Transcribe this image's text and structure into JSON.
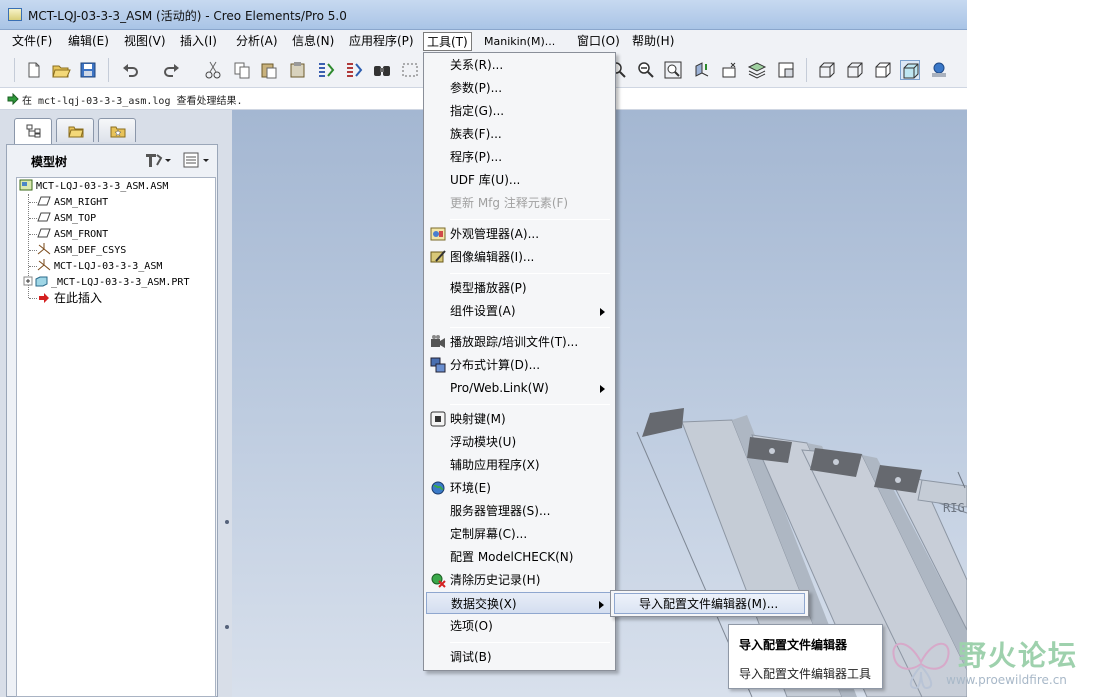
{
  "window": {
    "title": "MCT-LQJ-03-3-3_ASM (活动的) - Creo Elements/Pro 5.0"
  },
  "menubar": [
    {
      "label": "文件(F)"
    },
    {
      "label": "编辑(E)"
    },
    {
      "label": "视图(V)"
    },
    {
      "label": "插入(I)"
    },
    {
      "label": "分析(A)"
    },
    {
      "label": "信息(N)"
    },
    {
      "label": "应用程序(P)"
    },
    {
      "label": "工具(T)",
      "active": true
    },
    {
      "label": "Manikin(M)..."
    },
    {
      "label": "窗口(O)"
    },
    {
      "label": "帮助(H)"
    }
  ],
  "toolbar_icons": [
    "new-icon",
    "open-icon",
    "save-icon",
    "undo-icon",
    "redo-icon",
    "cut-icon",
    "copy-icon",
    "paste-icon",
    "paste-special-icon",
    "regenerate-icon",
    "regen-manager-icon",
    "find-icon",
    "select-box-icon",
    "zoom-in-icon",
    "zoom-out-icon",
    "refit-icon",
    "reorient-icon",
    "saved-views-icon",
    "layers-icon",
    "view-manager-icon",
    "wireframe-icon",
    "hidden-line-icon",
    "no-hidden-icon",
    "shading-icon",
    "enhanced-realism-icon"
  ],
  "message": {
    "text": "在 mct-lqj-03-3-3_asm.log 查看处理结果."
  },
  "navigator": {
    "tabs": [
      "model-tree-tab",
      "folder-browser-tab",
      "favorites-tab"
    ],
    "panel_label": "模型树",
    "tree": [
      {
        "label": "MCT-LQJ-03-3-3_ASM.ASM",
        "icon": "assembly-icon",
        "level": 0
      },
      {
        "label": "ASM_RIGHT",
        "icon": "datum-plane-icon",
        "level": 1
      },
      {
        "label": "ASM_TOP",
        "icon": "datum-plane-icon",
        "level": 1
      },
      {
        "label": "ASM_FRONT",
        "icon": "datum-plane-icon",
        "level": 1
      },
      {
        "label": "ASM_DEF_CSYS",
        "icon": "csys-icon",
        "level": 1
      },
      {
        "label": "MCT-LQJ-03-3-3_ASM",
        "icon": "csys-icon",
        "level": 1
      },
      {
        "label": "_MCT-LQJ-03-3-3_ASM.PRT",
        "icon": "part-icon",
        "level": 1,
        "expandable": true
      },
      {
        "label": "在此插入",
        "icon": "insert-here-icon",
        "level": 1
      }
    ]
  },
  "tools_menu": {
    "items": [
      {
        "label": "关系(R)...",
        "icon": ""
      },
      {
        "label": "参数(P)...",
        "icon": ""
      },
      {
        "label": "指定(G)...",
        "icon": ""
      },
      {
        "label": "族表(F)...",
        "icon": ""
      },
      {
        "label": "程序(P)...",
        "icon": ""
      },
      {
        "label": "UDF 库(U)...",
        "icon": ""
      },
      {
        "label": "更新 Mfg 注释元素(F)",
        "icon": "",
        "disabled": true
      },
      {
        "label": "外观管理器(A)...",
        "icon": "appearance-icon"
      },
      {
        "label": "图像编辑器(I)...",
        "icon": "image-editor-icon"
      },
      {
        "label": "模型播放器(P)",
        "icon": ""
      },
      {
        "label": "组件设置(A)",
        "icon": "",
        "submenu": true
      },
      {
        "label": "播放跟踪/培训文件(T)...",
        "icon": "trail-icon"
      },
      {
        "label": "分布式计算(D)...",
        "icon": "distributed-icon"
      },
      {
        "label": "Pro/Web.Link(W)",
        "icon": "",
        "submenu": true
      },
      {
        "label": "映射键(M)",
        "icon": "mapkey-icon"
      },
      {
        "label": "浮动模块(U)",
        "icon": ""
      },
      {
        "label": "辅助应用程序(X)",
        "icon": ""
      },
      {
        "label": "环境(E)",
        "icon": "environment-icon"
      },
      {
        "label": "服务器管理器(S)...",
        "icon": ""
      },
      {
        "label": "定制屏幕(C)...",
        "icon": ""
      },
      {
        "label": "配置 ModelCHECK(N)",
        "icon": ""
      },
      {
        "label": "清除历史记录(H)",
        "icon": "clear-history-icon"
      },
      {
        "label": "数据交换(X)",
        "icon": "",
        "submenu": true,
        "highlighted": true
      },
      {
        "label": "选项(O)",
        "icon": ""
      },
      {
        "label": "调试(B)",
        "icon": ""
      }
    ]
  },
  "submenu": {
    "item": "导入配置文件编辑器(M)..."
  },
  "tooltip": {
    "title": "导入配置文件编辑器",
    "body": "导入配置文件编辑器工具"
  },
  "graphics": {
    "datum_label": "RIG"
  },
  "watermark": {
    "text": "野火论坛",
    "url": "www.proewildfire.cn"
  },
  "colors": {
    "menu_highlight": "#d4def0",
    "graphics_bg_top": "#a4b7d2",
    "graphics_bg_bottom": "#d8e0ec",
    "model_face": "#c6cdd6",
    "model_tab": "#6b6e74"
  }
}
